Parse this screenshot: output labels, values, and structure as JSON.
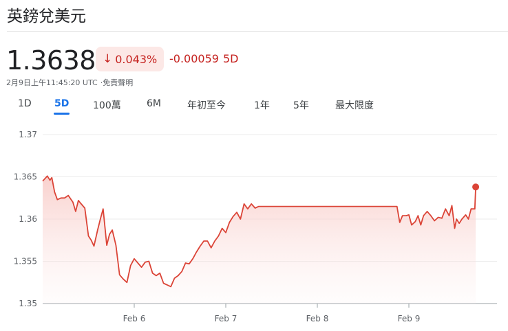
{
  "header": {
    "title": "英鎊兌美元"
  },
  "quote": {
    "price": "1.3638",
    "change_percent": "0.043%",
    "change_direction_icon": "arrow-down-icon",
    "change_abs": "-0.00059",
    "change_period": "5D",
    "timestamp": "2月9日上午11:45:20 UTC",
    "disclaimer": "·免責聲明",
    "negative_color": "#c5221f",
    "negative_bg": "#fce8e6"
  },
  "range_tabs": [
    {
      "label": "1D",
      "active": false
    },
    {
      "label": "5D",
      "active": true
    },
    {
      "label": "100萬",
      "active": false
    },
    {
      "label": "6M",
      "active": false
    },
    {
      "label": "年初至今",
      "active": false
    },
    {
      "label": "1年",
      "active": false
    },
    {
      "label": "5年",
      "active": false
    },
    {
      "label": "最大限度",
      "active": false
    }
  ],
  "chart_data": {
    "type": "area",
    "title": "",
    "xlabel": "",
    "ylabel": "",
    "ylim": [
      1.35,
      1.37
    ],
    "y_ticks": [
      "1.37",
      "1.365",
      "1.36",
      "1.355",
      "1.35"
    ],
    "x_tick_labels": [
      "Feb 6",
      "Feb 7",
      "Feb 8",
      "Feb 9"
    ],
    "x_tick_positions": [
      1,
      2,
      3,
      4
    ],
    "xlim": [
      0.0,
      4.98
    ],
    "grid": true,
    "line_color": "#db4437",
    "last_point_marker": true,
    "series": [
      {
        "values": [
          [
            0.0,
            1.3645
          ],
          [
            0.05,
            1.3651
          ],
          [
            0.08,
            1.3646
          ],
          [
            0.1,
            1.3649
          ],
          [
            0.13,
            1.3632
          ],
          [
            0.16,
            1.3623
          ],
          [
            0.2,
            1.3625
          ],
          [
            0.24,
            1.3625
          ],
          [
            0.28,
            1.3628
          ],
          [
            0.33,
            1.362
          ],
          [
            0.36,
            1.3609
          ],
          [
            0.39,
            1.3622
          ],
          [
            0.42,
            1.3618
          ],
          [
            0.46,
            1.3613
          ],
          [
            0.5,
            1.358
          ],
          [
            0.53,
            1.3575
          ],
          [
            0.56,
            1.3568
          ],
          [
            0.6,
            1.3587
          ],
          [
            0.63,
            1.36
          ],
          [
            0.66,
            1.3612
          ],
          [
            0.7,
            1.3569
          ],
          [
            0.73,
            1.3582
          ],
          [
            0.76,
            1.3587
          ],
          [
            0.8,
            1.3569
          ],
          [
            0.84,
            1.3534
          ],
          [
            0.88,
            1.3529
          ],
          [
            0.92,
            1.3525
          ],
          [
            0.96,
            1.3545
          ],
          [
            1.0,
            1.3553
          ],
          [
            1.04,
            1.3548
          ],
          [
            1.08,
            1.3543
          ],
          [
            1.12,
            1.3549
          ],
          [
            1.16,
            1.355
          ],
          [
            1.2,
            1.3536
          ],
          [
            1.24,
            1.3533
          ],
          [
            1.28,
            1.3536
          ],
          [
            1.32,
            1.3524
          ],
          [
            1.36,
            1.3522
          ],
          [
            1.4,
            1.352
          ],
          [
            1.44,
            1.353
          ],
          [
            1.48,
            1.3533
          ],
          [
            1.52,
            1.3538
          ],
          [
            1.56,
            1.3548
          ],
          [
            1.6,
            1.3547
          ],
          [
            1.64,
            1.3553
          ],
          [
            1.68,
            1.3561
          ],
          [
            1.72,
            1.3568
          ],
          [
            1.76,
            1.3574
          ],
          [
            1.8,
            1.3574
          ],
          [
            1.84,
            1.3566
          ],
          [
            1.88,
            1.3574
          ],
          [
            1.92,
            1.358
          ],
          [
            1.96,
            1.3589
          ],
          [
            2.0,
            1.3584
          ],
          [
            2.04,
            1.3596
          ],
          [
            2.08,
            1.3603
          ],
          [
            2.12,
            1.3608
          ],
          [
            2.16,
            1.36
          ],
          [
            2.2,
            1.3618
          ],
          [
            2.24,
            1.3612
          ],
          [
            2.28,
            1.3618
          ],
          [
            2.32,
            1.3613
          ],
          [
            2.36,
            1.3615
          ],
          [
            2.4,
            1.3615
          ],
          [
            2.44,
            1.3615
          ],
          [
            2.5,
            1.3615
          ],
          [
            2.6,
            1.3615
          ],
          [
            2.7,
            1.3615
          ],
          [
            2.8,
            1.3615
          ],
          [
            2.9,
            1.3615
          ],
          [
            3.0,
            1.3615
          ],
          [
            3.1,
            1.3615
          ],
          [
            3.2,
            1.3615
          ],
          [
            3.3,
            1.3615
          ],
          [
            3.4,
            1.3615
          ],
          [
            3.5,
            1.3615
          ],
          [
            3.6,
            1.3615
          ],
          [
            3.7,
            1.3615
          ],
          [
            3.8,
            1.3615
          ],
          [
            3.87,
            1.3615
          ],
          [
            3.9,
            1.3596
          ],
          [
            3.93,
            1.3604
          ],
          [
            3.97,
            1.3604
          ],
          [
            4.0,
            1.3605
          ],
          [
            4.03,
            1.3593
          ],
          [
            4.07,
            1.3597
          ],
          [
            4.1,
            1.3604
          ],
          [
            4.13,
            1.3593
          ],
          [
            4.16,
            1.3604
          ],
          [
            4.2,
            1.3609
          ],
          [
            4.24,
            1.3604
          ],
          [
            4.28,
            1.3598
          ],
          [
            4.32,
            1.3602
          ],
          [
            4.36,
            1.3601
          ],
          [
            4.4,
            1.3612
          ],
          [
            4.44,
            1.3604
          ],
          [
            4.47,
            1.3616
          ],
          [
            4.5,
            1.3589
          ],
          [
            4.52,
            1.36
          ],
          [
            4.55,
            1.3595
          ],
          [
            4.58,
            1.36
          ],
          [
            4.62,
            1.3605
          ],
          [
            4.65,
            1.36
          ],
          [
            4.68,
            1.3612
          ],
          [
            4.72,
            1.3612
          ],
          [
            4.73,
            1.3638
          ]
        ]
      }
    ]
  }
}
